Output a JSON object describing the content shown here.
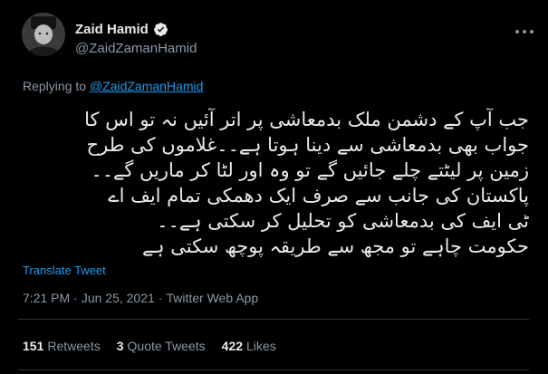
{
  "author": {
    "name": "Zaid Hamid",
    "handle": "@ZaidZamanHamid",
    "verified": true,
    "badge_color": "#e7e9ea"
  },
  "reply": {
    "prefix": "Replying to",
    "to": "@ZaidZamanHamid"
  },
  "tweet": {
    "lines": [
      "جب آپ کے دشمن ملک بدمعاشی پر اتر آئیں نہ تو اس کا",
      "جواب بھی بدمعاشی سے دینا ہوتا ہے۔۔غلاموں کی طرح",
      "زمین پر لیٹتے چلے جائیں گے تو وہ اور لٹا کر ماریں گے۔۔",
      "پاکستان کی جانب سے صرف ایک دھمکی  تمام ایف اے",
      "ٹی ایف کی بدمعاشی کو تحلیل کر سکتی ہے۔۔",
      "حکومت چاہے تو مجھ سے طریقہ پوچھ سکتی ہے"
    ],
    "translate_label": "Translate Tweet"
  },
  "meta": {
    "time": "7:21 PM",
    "date": "Jun 25, 2021",
    "source": "Twitter Web App",
    "dot": "·"
  },
  "stats": {
    "retweets_count": "151",
    "retweets_label": "Retweets",
    "quotes_count": "3",
    "quotes_label": "Quote Tweets",
    "likes_count": "422",
    "likes_label": "Likes"
  },
  "colors": {
    "background": "#000000",
    "link": "#1d9bf0",
    "muted": "#8b98a5"
  }
}
